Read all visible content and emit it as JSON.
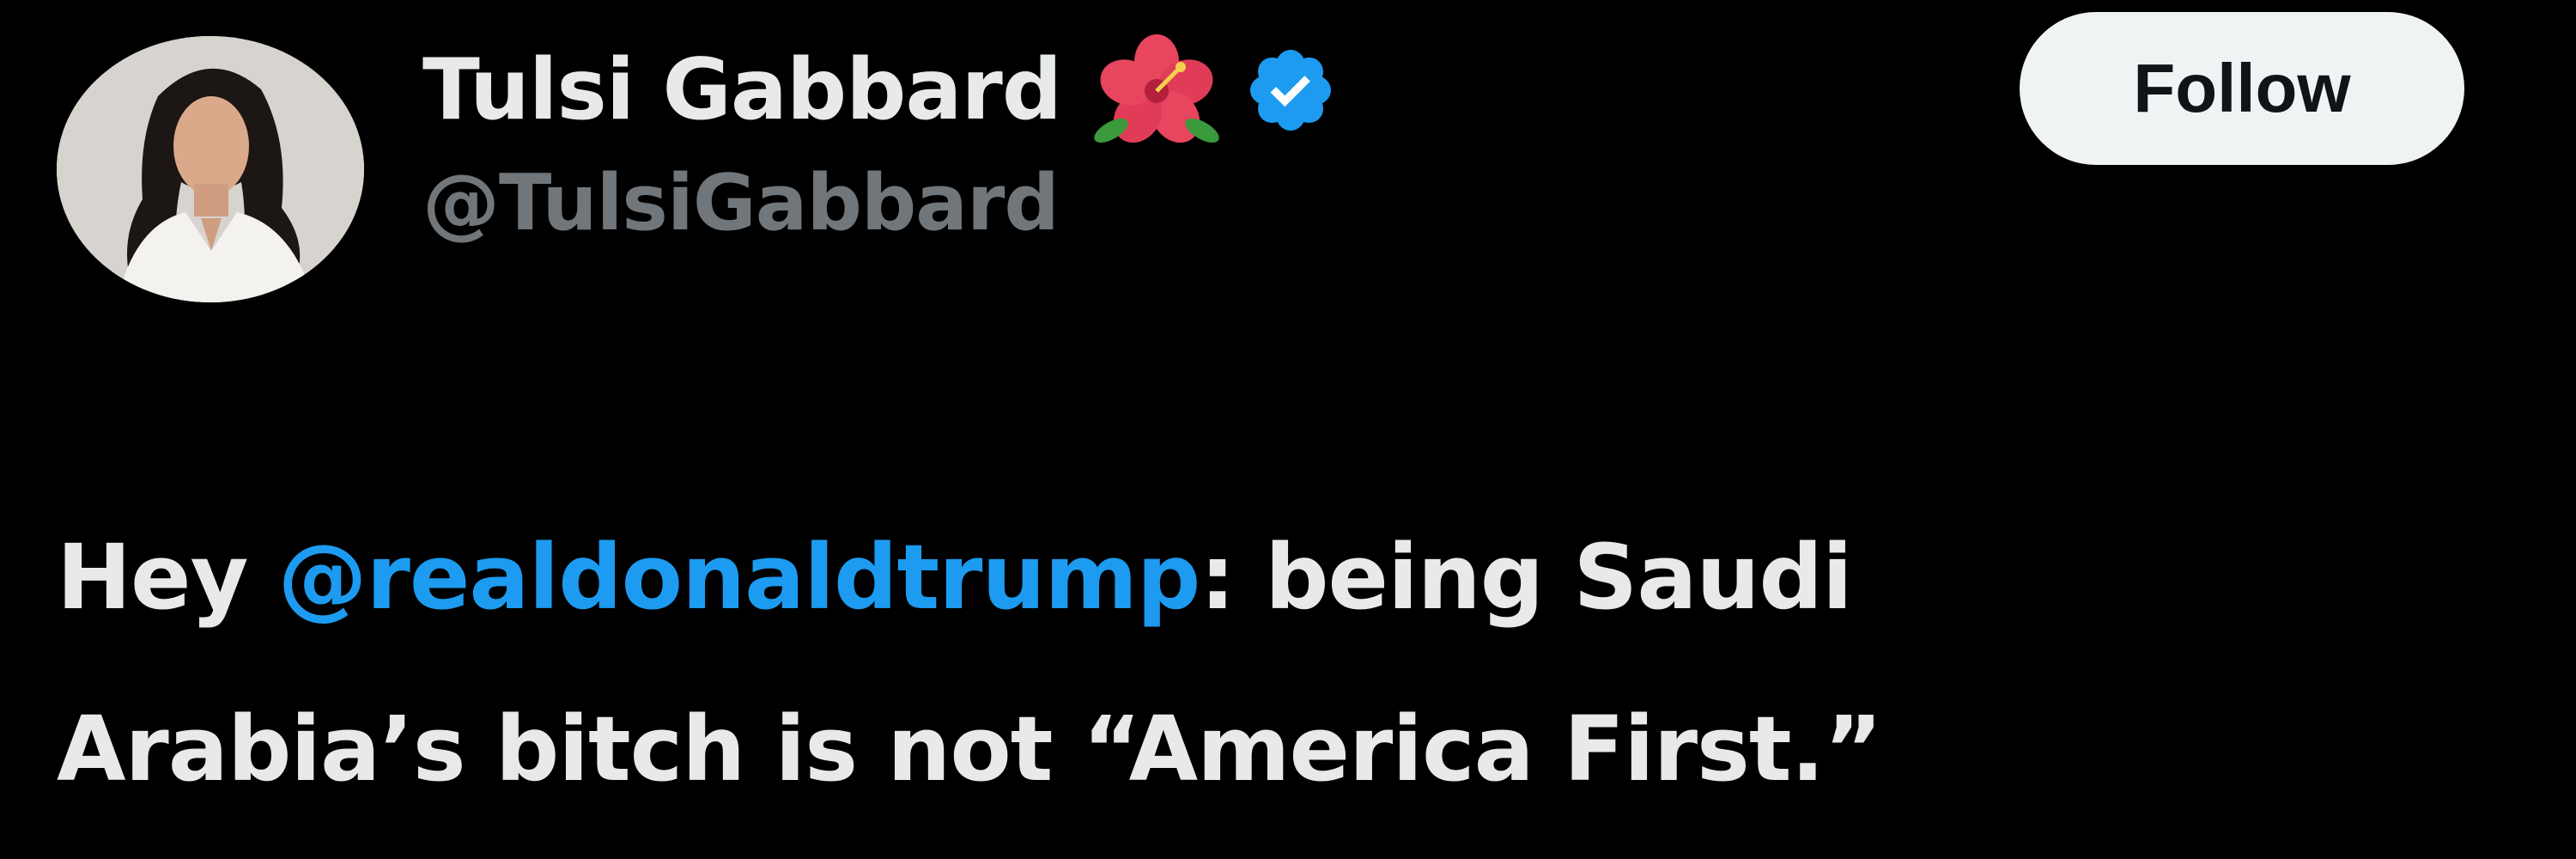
{
  "tweet": {
    "author": {
      "display_name": "Tulsi Gabbard",
      "handle": "@TulsiGabbard",
      "name_emoji": "hibiscus-icon",
      "verified_badge": "verified-icon",
      "verified_color": "#1d9bf0"
    },
    "follow_label": "Follow",
    "text": {
      "line1_prefix": "Hey ",
      "mention": "@realdonaldtrump",
      "line1_suffix": ": being Saudi",
      "line2": "Arabia’s bitch is not “America First.”"
    },
    "colors": {
      "background": "#000000",
      "primary_text": "#e7e9ea",
      "secondary_text": "#71767b",
      "link": "#1d9bf0",
      "button_bg": "#eff3f4",
      "button_text": "#0f1419"
    }
  }
}
